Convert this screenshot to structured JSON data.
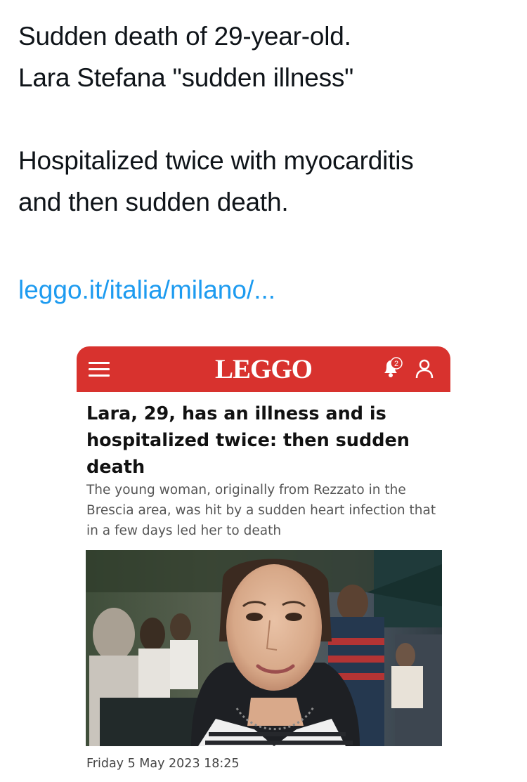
{
  "tweet": {
    "lines": [
      "Sudden death of 29-year-old.",
      "Lara Stefana \"sudden illness\"",
      "Hospitalized twice with myocarditis",
      "and then sudden death."
    ],
    "link": "leggo.it/italia/milano/..."
  },
  "card": {
    "logo": "LEGGO",
    "notification_count": "2",
    "headline": "Lara, 29, has an illness and is hospitalized twice: then sudden death",
    "subtitle": "The young woman, originally from Rezzato in the Brescia area, was hit by a sudden heart infection that in a few days led her to death",
    "date": "Friday 5 May 2023 18:25",
    "colors": {
      "header": "#d8322e",
      "link": "#1d9bf0"
    },
    "icons": {
      "menu": "hamburger-icon",
      "notifications": "bell-icon",
      "account": "user-icon"
    }
  }
}
